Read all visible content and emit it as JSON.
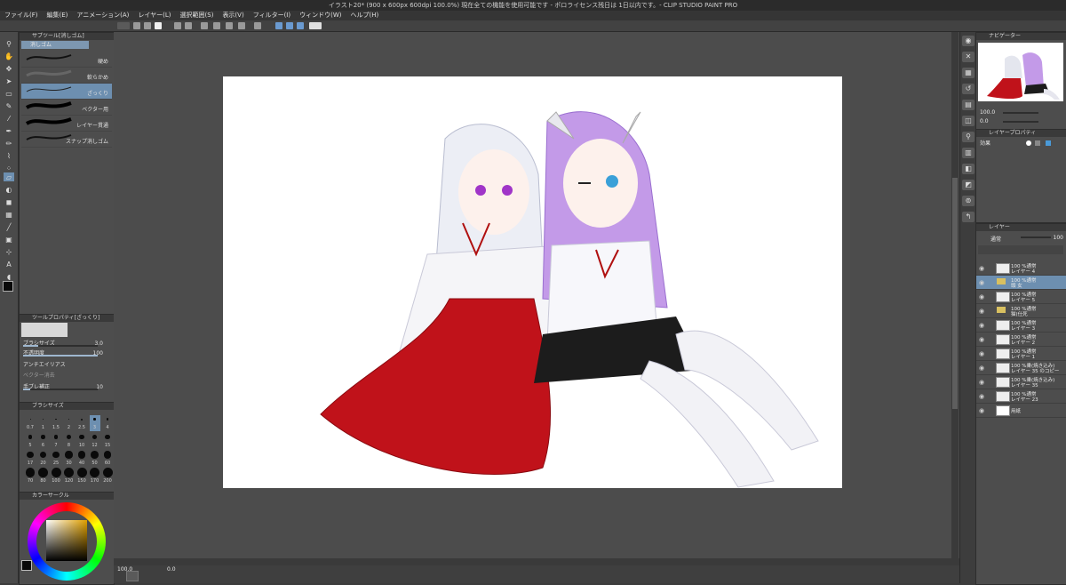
{
  "app_title": "イラスト20* (900 x 600px 600dpi 100.0%) 現在全ての機能を使用可能です - ポロライセンス残日は 1日以内です。- CLIP STUDIO PAINT PRO",
  "menu": [
    "ファイル(F)",
    "編集(E)",
    "アニメーション(A)",
    "レイヤー(L)",
    "選択範囲(S)",
    "表示(V)",
    "フィルター(I)",
    "ウィンドウ(W)",
    "ヘルプ(H)"
  ],
  "sub_tool": {
    "header": "サブツール[消しゴム]",
    "tab": "消しゴム",
    "items": [
      {
        "label": "硬め"
      },
      {
        "label": "軟らかめ"
      },
      {
        "label": "ざっくり"
      },
      {
        "label": "ベクター用"
      },
      {
        "label": "レイヤー貫通"
      },
      {
        "label": "スナップ消しゴム"
      }
    ]
  },
  "tool_property": {
    "header": "ツールプロパティ[ざっくり]",
    "brush_size_label": "ブラシサイズ",
    "brush_size_value": "3.0",
    "opacity_label": "不透明度",
    "opacity_value": "100",
    "antialias_label": "アンチエイリアス",
    "vector_label": "ベクター消去",
    "stabilize_label": "手ブレ補正",
    "stabilize_value": "10"
  },
  "brush_size": {
    "header": "ブラシサイズ",
    "sizes": [
      "0.7",
      "1",
      "1.5",
      "2",
      "2.5",
      "3",
      "4",
      "5",
      "6",
      "7",
      "8",
      "10",
      "12",
      "15",
      "17",
      "20",
      "25",
      "30",
      "40",
      "50",
      "60",
      "70",
      "80",
      "100",
      "120",
      "150",
      "170",
      "200"
    ]
  },
  "color": {
    "header": "カラーサークル",
    "main_color": "#0a0a0a",
    "hue_color": "#e0a000"
  },
  "navigator": {
    "header": "ナビゲーター",
    "zoom": "100.0",
    "angle": "0.0"
  },
  "layer_property": {
    "header": "レイヤープロパティ",
    "effect_label": "効果"
  },
  "layers": {
    "header": "レイヤー",
    "blend_mode": "通常",
    "opacity": "100",
    "items": [
      {
        "line1": "100 %通常",
        "line2": "レイヤー 4",
        "type": "raster"
      },
      {
        "line1": "100 %通常",
        "line2": "頭 女",
        "type": "folder"
      },
      {
        "line1": "100 %通常",
        "line2": "レイヤー 5",
        "type": "raster"
      },
      {
        "line1": "100 %通常",
        "line2": "猫(仕死",
        "type": "folder"
      },
      {
        "line1": "100 %通常",
        "line2": "レイヤー 3",
        "type": "raster"
      },
      {
        "line1": "100 %通常",
        "line2": "レイヤー 2",
        "type": "raster"
      },
      {
        "line1": "100 %通常",
        "line2": "レイヤー 1",
        "type": "raster"
      },
      {
        "line1": "100 %乗(焼き込み)",
        "line2": "レイヤー 35 のコピー",
        "type": "raster"
      },
      {
        "line1": "100 %乗(焼き込み)",
        "line2": "レイヤー 35",
        "type": "raster"
      },
      {
        "line1": "100 %通常",
        "line2": "レイヤー 23",
        "type": "raster"
      },
      {
        "line1": "",
        "line2": "用紙",
        "type": "paper"
      }
    ]
  },
  "status": {
    "zoom": "100.0",
    "angle": "0.0"
  }
}
